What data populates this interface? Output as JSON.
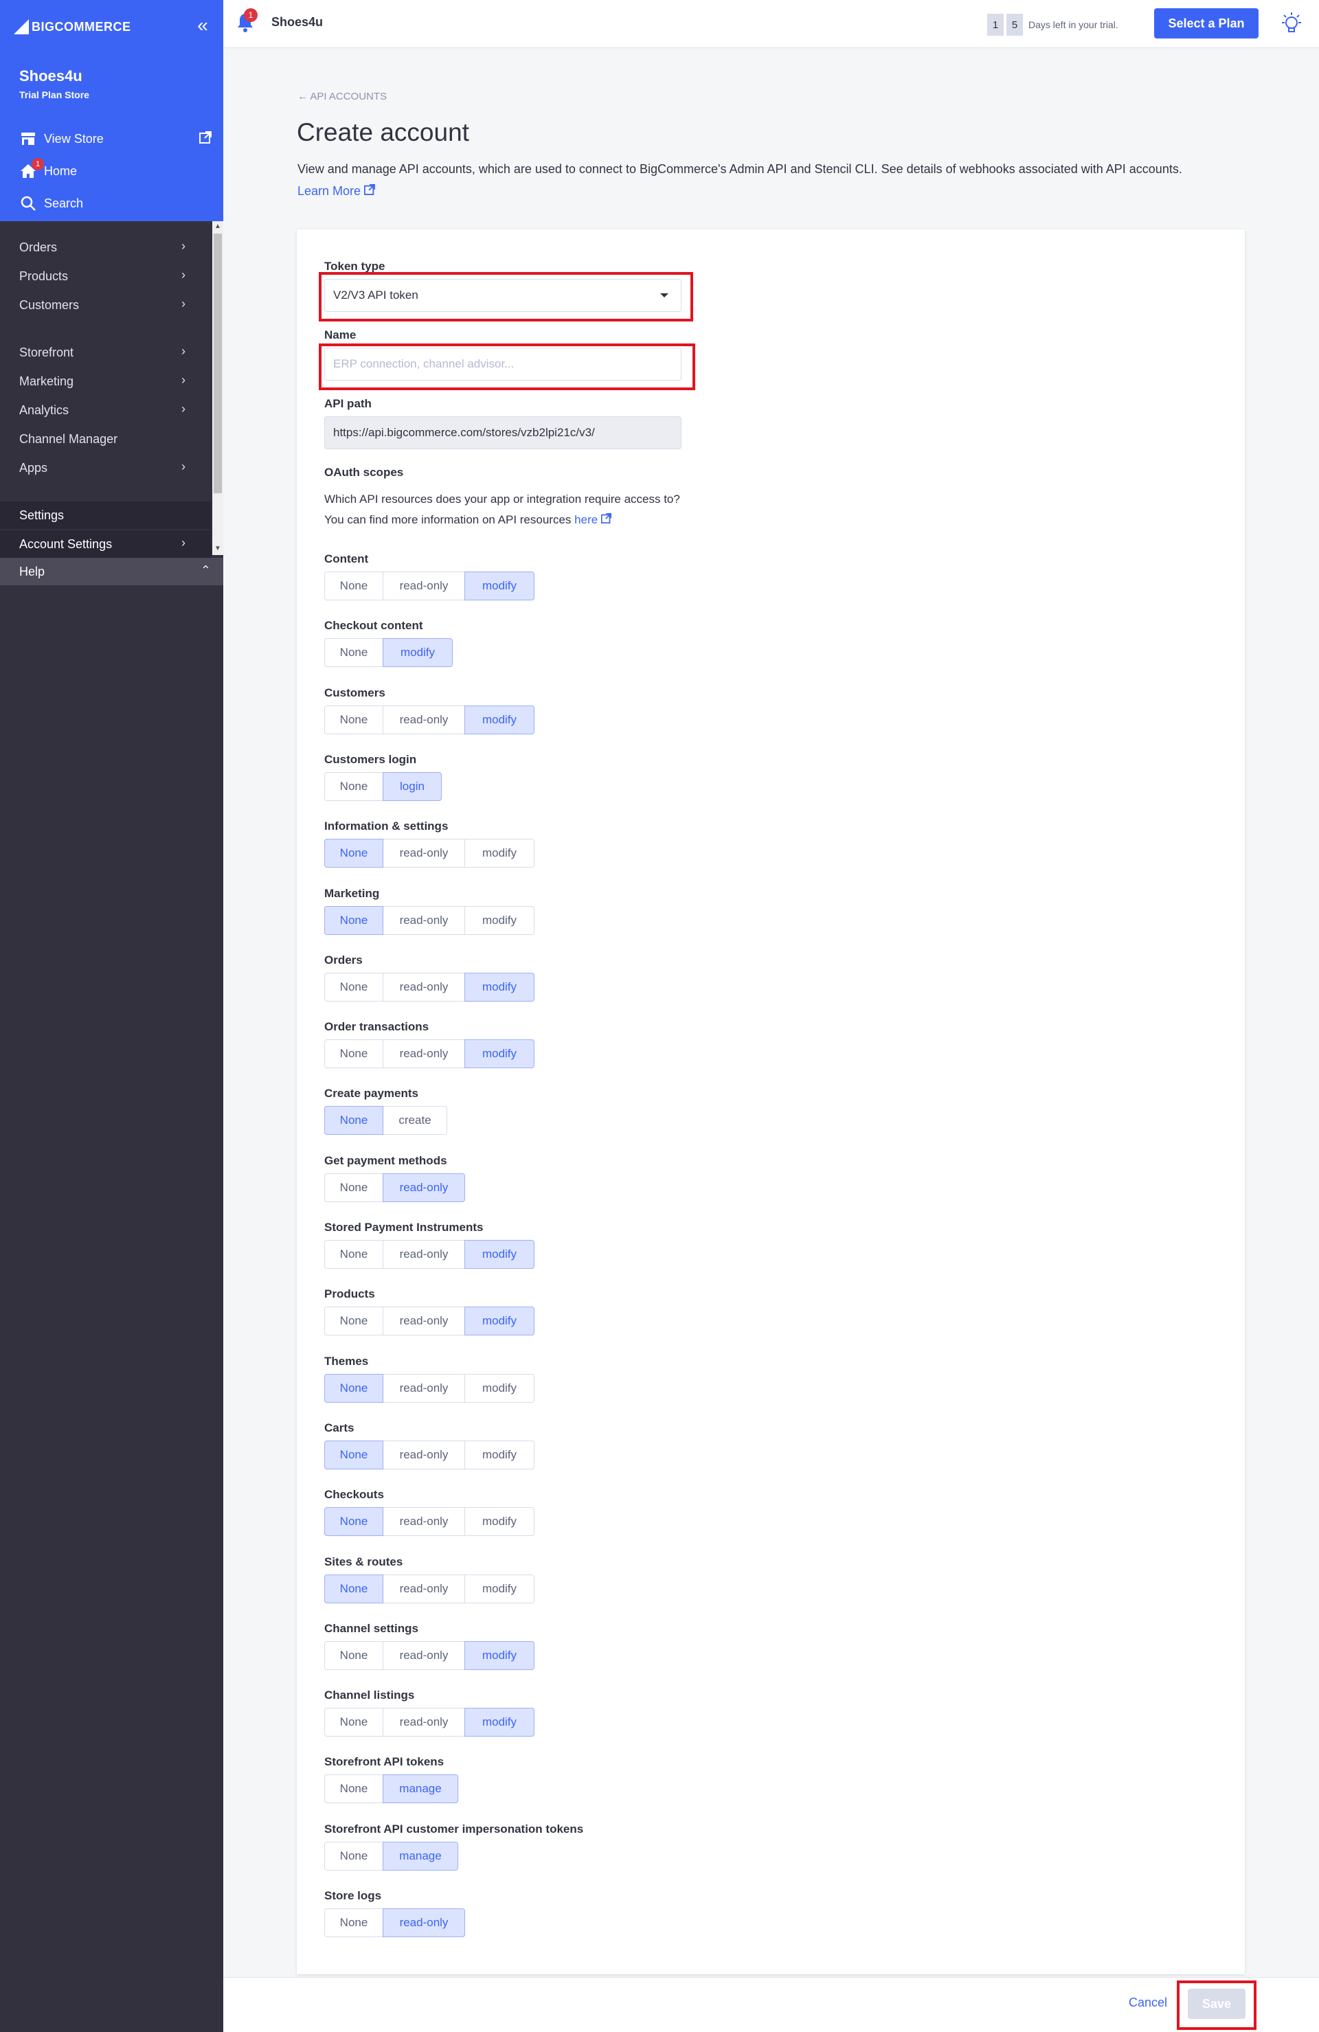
{
  "sidebar": {
    "brand": "BIGCOMMERCE",
    "store_name": "Shoes4u",
    "store_plan": "Trial Plan Store",
    "view_store": "View Store",
    "home": "Home",
    "home_badge": "1",
    "search": "Search",
    "nav": [
      {
        "label": "Orders",
        "chevron": "›"
      },
      {
        "label": "Products",
        "chevron": "›"
      },
      {
        "label": "Customers",
        "chevron": "›"
      },
      {
        "label": "Storefront",
        "chevron": "›"
      },
      {
        "label": "Marketing",
        "chevron": "›"
      },
      {
        "label": "Analytics",
        "chevron": "›"
      },
      {
        "label": "Channel Manager",
        "chevron": ""
      },
      {
        "label": "Apps",
        "chevron": "›"
      },
      {
        "label": "Settings",
        "chevron": ""
      },
      {
        "label": "Account Settings",
        "chevron": "›"
      },
      {
        "label": "Help",
        "chevron": "⌃"
      }
    ],
    "colors": {
      "header_bg": "#3c64f4",
      "body_bg": "#34313f"
    }
  },
  "topbar": {
    "notification_badge": "1",
    "store_name": "Shoes4u",
    "trial_digit_1": "1",
    "trial_digit_2": "5",
    "trial_text": "Days left in your trial.",
    "select_plan": "Select a Plan"
  },
  "page": {
    "breadcrumb": "← API ACCOUNTS",
    "title": "Create account",
    "description": "View and manage API accounts, which are used to connect to BigCommerce's Admin API and Stencil CLI. See details of webhooks associated with API accounts.",
    "learn_more": "Learn More"
  },
  "form": {
    "token_type_label": "Token type",
    "token_type_value": "V2/V3 API token",
    "name_label": "Name",
    "name_placeholder": "ERP connection, channel advisor...",
    "api_path_label": "API path",
    "api_path_value": "https://api.bigcommerce.com/stores/vzb2lpi21c/v3/",
    "oauth_label": "OAuth scopes",
    "oauth_hint_1": "Which API resources does your app or integration require access to?",
    "oauth_hint_2": "You can find more information on API resources",
    "oauth_hint_link": "here"
  },
  "scopes": [
    {
      "label": "Content",
      "options": [
        "None",
        "read-only",
        "modify"
      ],
      "selected": 2
    },
    {
      "label": "Checkout content",
      "options": [
        "None",
        "modify"
      ],
      "selected": 1
    },
    {
      "label": "Customers",
      "options": [
        "None",
        "read-only",
        "modify"
      ],
      "selected": 2
    },
    {
      "label": "Customers login",
      "options": [
        "None",
        "login"
      ],
      "selected": 1
    },
    {
      "label": "Information & settings",
      "options": [
        "None",
        "read-only",
        "modify"
      ],
      "selected": 0
    },
    {
      "label": "Marketing",
      "options": [
        "None",
        "read-only",
        "modify"
      ],
      "selected": 0
    },
    {
      "label": "Orders",
      "options": [
        "None",
        "read-only",
        "modify"
      ],
      "selected": 2
    },
    {
      "label": "Order transactions",
      "options": [
        "None",
        "read-only",
        "modify"
      ],
      "selected": 2
    },
    {
      "label": "Create payments",
      "options": [
        "None",
        "create"
      ],
      "selected": 0
    },
    {
      "label": "Get payment methods",
      "options": [
        "None",
        "read-only"
      ],
      "selected": 1
    },
    {
      "label": "Stored Payment Instruments",
      "options": [
        "None",
        "read-only",
        "modify"
      ],
      "selected": 2
    },
    {
      "label": "Products",
      "options": [
        "None",
        "read-only",
        "modify"
      ],
      "selected": 2
    },
    {
      "label": "Themes",
      "options": [
        "None",
        "read-only",
        "modify"
      ],
      "selected": 0
    },
    {
      "label": "Carts",
      "options": [
        "None",
        "read-only",
        "modify"
      ],
      "selected": 0
    },
    {
      "label": "Checkouts",
      "options": [
        "None",
        "read-only",
        "modify"
      ],
      "selected": 0
    },
    {
      "label": "Sites & routes",
      "options": [
        "None",
        "read-only",
        "modify"
      ],
      "selected": 0
    },
    {
      "label": "Channel settings",
      "options": [
        "None",
        "read-only",
        "modify"
      ],
      "selected": 2
    },
    {
      "label": "Channel listings",
      "options": [
        "None",
        "read-only",
        "modify"
      ],
      "selected": 2
    },
    {
      "label": "Storefront API tokens",
      "options": [
        "None",
        "manage"
      ],
      "selected": 1
    },
    {
      "label": "Storefront API customer impersonation tokens",
      "options": [
        "None",
        "manage"
      ],
      "selected": 1
    },
    {
      "label": "Store logs",
      "options": [
        "None",
        "read-only"
      ],
      "selected": 1
    }
  ],
  "footer": {
    "cancel": "Cancel",
    "save": "Save"
  },
  "colors": {
    "accent": "#3c64f4",
    "highlight_box": "#e01521",
    "selected_bg": "#dbe3fe"
  }
}
